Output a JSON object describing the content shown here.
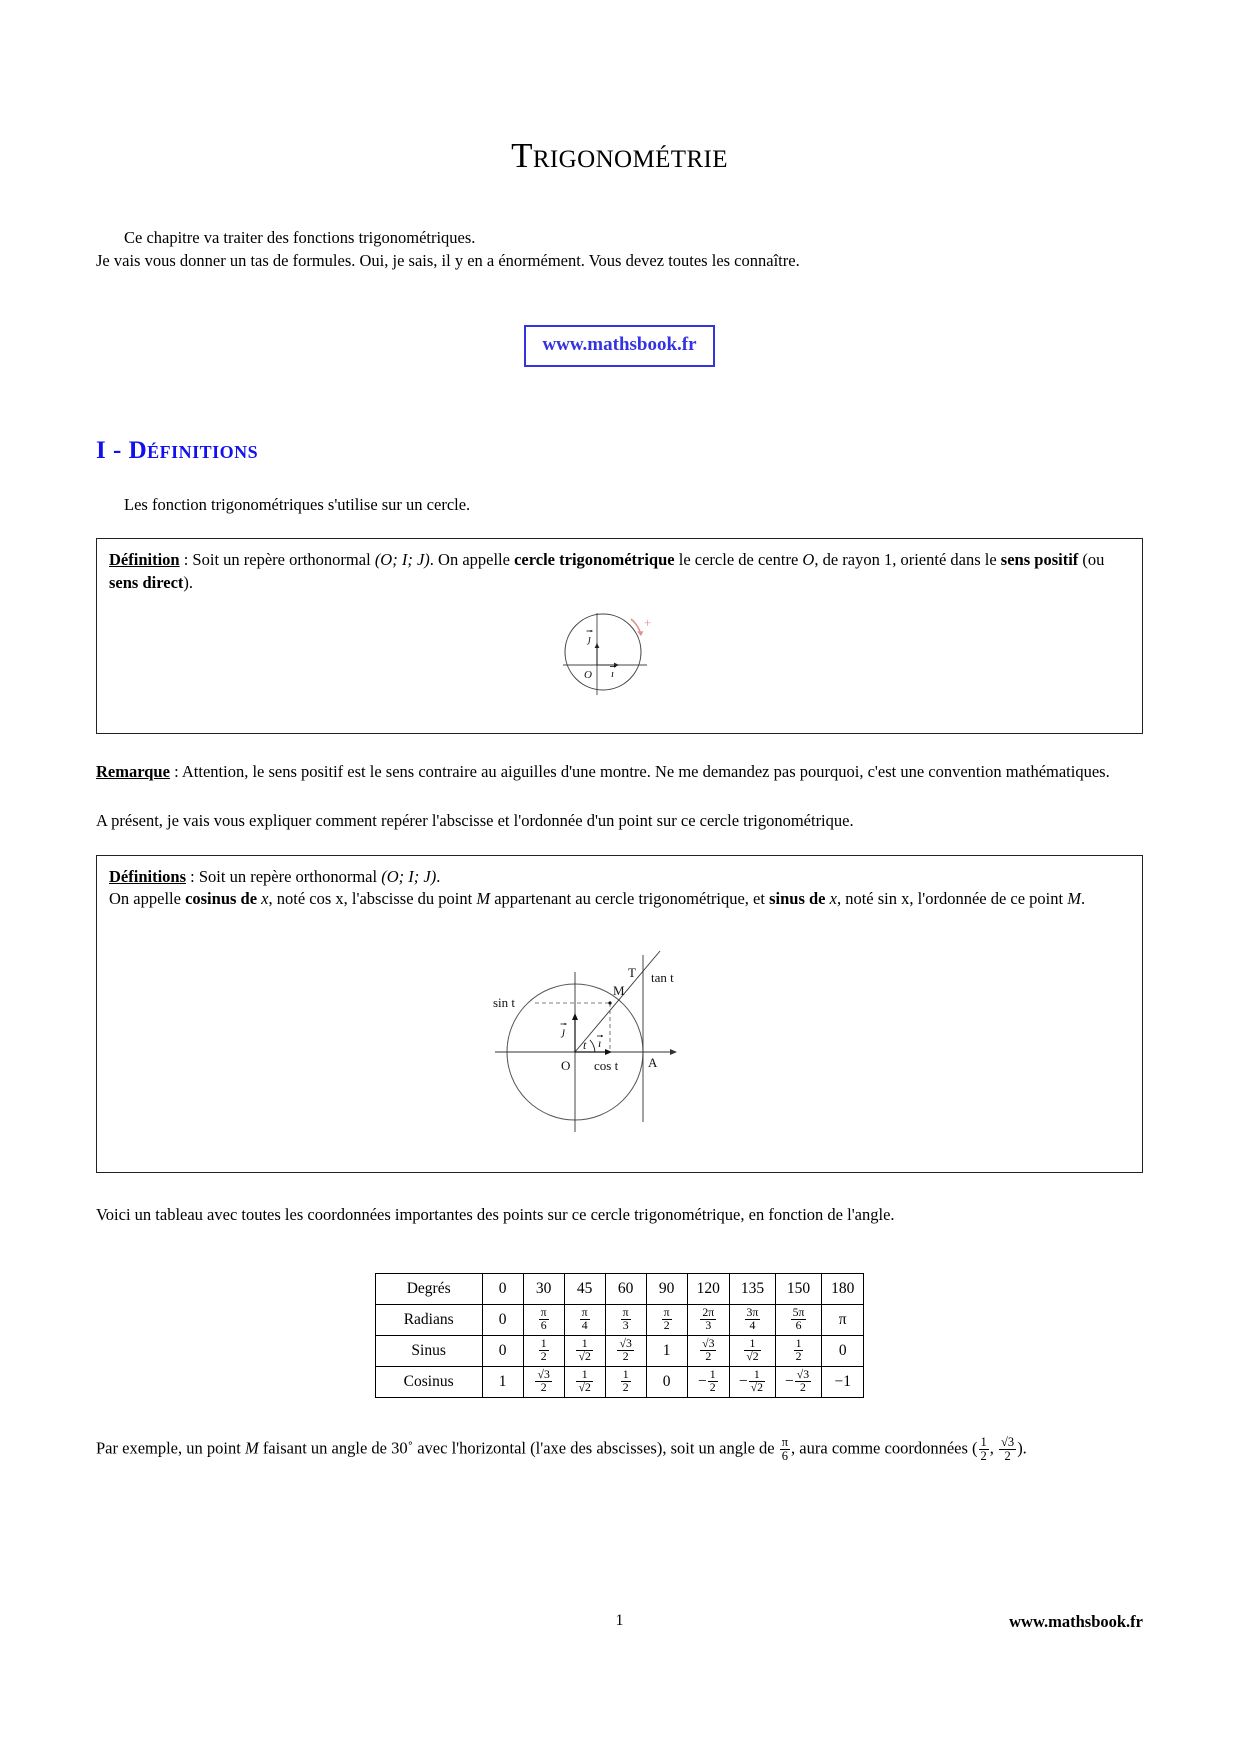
{
  "document": {
    "title": "Trigonométrie",
    "intro_line_1": "Ce chapitre va traiter des fonctions trigonométriques.",
    "intro_line_2": "Je vais vous donner un tas de formules. Oui, je sais, il y en a énormément. Vous devez toutes les connaître.",
    "url_box": "www.mathsbook.fr",
    "accent_blue": "#1111ee",
    "link_blue": "#3333e0",
    "page_number": "1",
    "footer_right": "www.mathsbook.fr"
  },
  "section": {
    "number": "I",
    "dash": "-",
    "title": "Définitions",
    "lead_paragraph": "Les fonction trigonométriques s'utilise sur un cercle."
  },
  "definition_box_1": {
    "label": "Définition",
    "text_before_bold": " : Soit un repère orthonormal ",
    "repere": "(O; I; J)",
    "text_mid": ". On appelle ",
    "bold_term": "cercle trigonométrique",
    "text_after": " le cercle de centre ",
    "center_symbol": "O",
    "text_radius": ", de rayon 1, orienté dans le ",
    "bold_sens_1": "sens positif",
    "text_ou": " (ou ",
    "bold_sens_2": "sens direct",
    "text_end": ").",
    "figure": {
      "name": "unit-circle-orientation",
      "labels": {
        "j_vector": "ȷ⃗",
        "i_vector": "ı⃗",
        "origin": "O",
        "plus_sign": "+"
      },
      "arc_color": "#e08080"
    }
  },
  "remark": {
    "label": "Remarque",
    "text": " : Attention, le sens positif est le sens contraire au aiguilles d'une montre. Ne me demandez pas pourquoi, c'est une convention mathématiques."
  },
  "transition_paragraph": "A présent, je vais vous expliquer comment repérer l'abscisse et l'ordonnée d'un point sur ce cercle trigonométrique.",
  "definition_box_2": {
    "label": "Définitions",
    "line1_text": " : Soit un repère orthonormal ",
    "line1_repere": "(O; I; J)",
    "line1_end": ".",
    "line2_a": "On appelle ",
    "line2_bold1": "cosinus de",
    "line2_var1": "x",
    "line2_b": ", noté ",
    "line2_cos": "cos x",
    "line2_c": ", l'abscisse du point ",
    "line2_M": "M",
    "line2_d": " appartenant au cercle trigonométrique, et ",
    "line2_bold2": "sinus de",
    "line2_var2": "x",
    "line2_e": ", noté ",
    "line3_sin": "sin x",
    "line3_b": ", l'ordonnée de ce point ",
    "line3_M": "M",
    "line3_end": ".",
    "figure": {
      "name": "trig-circle-sin-cos-tan",
      "labels": {
        "T": "T",
        "tan": "tan t",
        "M": "M",
        "sin": "sin t",
        "cos": "cos t",
        "j_vector": "ȷ⃗",
        "i_vector": "ı⃗",
        "angle": "t",
        "origin": "O",
        "A": "A"
      }
    }
  },
  "table_intro": "Voici un tableau avec toutes les coordonnées importantes des points sur ce cercle trigonométrique, en fonction de l'angle.",
  "trig_table": {
    "rows": [
      {
        "header": "Degrés",
        "cells": [
          {
            "type": "plain",
            "value": "0"
          },
          {
            "type": "plain",
            "value": "30"
          },
          {
            "type": "plain",
            "value": "45"
          },
          {
            "type": "plain",
            "value": "60"
          },
          {
            "type": "plain",
            "value": "90"
          },
          {
            "type": "plain",
            "value": "120"
          },
          {
            "type": "plain",
            "value": "135"
          },
          {
            "type": "plain",
            "value": "150"
          },
          {
            "type": "plain",
            "value": "180"
          }
        ]
      },
      {
        "header": "Radians",
        "cells": [
          {
            "type": "plain",
            "value": "0"
          },
          {
            "type": "frac",
            "num": "π",
            "den": "6"
          },
          {
            "type": "frac",
            "num": "π",
            "den": "4"
          },
          {
            "type": "frac",
            "num": "π",
            "den": "3"
          },
          {
            "type": "frac",
            "num": "π",
            "den": "2"
          },
          {
            "type": "frac",
            "num": "2π",
            "den": "3"
          },
          {
            "type": "frac",
            "num": "3π",
            "den": "4"
          },
          {
            "type": "frac",
            "num": "5π",
            "den": "6"
          },
          {
            "type": "plain",
            "value": "π"
          }
        ]
      },
      {
        "header": "Sinus",
        "cells": [
          {
            "type": "plain",
            "value": "0"
          },
          {
            "type": "frac",
            "num": "1",
            "den": "2"
          },
          {
            "type": "frac",
            "num": "1",
            "den": "√2"
          },
          {
            "type": "frac",
            "num": "√3",
            "den": "2"
          },
          {
            "type": "plain",
            "value": "1"
          },
          {
            "type": "frac",
            "num": "√3",
            "den": "2"
          },
          {
            "type": "frac",
            "num": "1",
            "den": "√2"
          },
          {
            "type": "frac",
            "num": "1",
            "den": "2"
          },
          {
            "type": "plain",
            "value": "0"
          }
        ]
      },
      {
        "header": "Cosinus",
        "cells": [
          {
            "type": "plain",
            "value": "1"
          },
          {
            "type": "frac",
            "num": "√3",
            "den": "2"
          },
          {
            "type": "frac",
            "num": "1",
            "den": "√2"
          },
          {
            "type": "frac",
            "num": "1",
            "den": "2"
          },
          {
            "type": "plain",
            "value": "0"
          },
          {
            "type": "frac",
            "num": "1",
            "den": "2",
            "sign": "−"
          },
          {
            "type": "frac",
            "num": "1",
            "den": "√2",
            "sign": "−"
          },
          {
            "type": "frac",
            "num": "√3",
            "den": "2",
            "sign": "−"
          },
          {
            "type": "plain",
            "value": "−1"
          }
        ]
      }
    ]
  },
  "example": {
    "a": "Par exemple, un point ",
    "M": "M",
    "b": " faisant un angle de 30˚ avec l'horizontal (l'axe des abscisses), soit un angle de ",
    "frac_num": "π",
    "frac_den": "6",
    "c": ", aura comme coordonnées (",
    "coord1_num": "1",
    "coord1_den": "2",
    "comma": ", ",
    "coord2_num": "√3",
    "coord2_den": "2",
    "d": ")."
  }
}
